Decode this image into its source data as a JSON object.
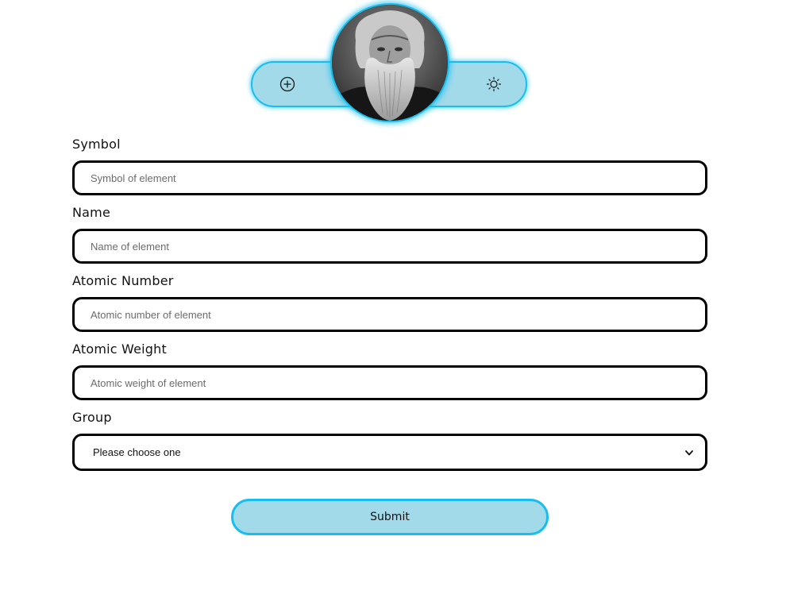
{
  "header": {
    "add_icon": "plus-circle-icon",
    "theme_icon": "sun-icon",
    "portrait_alt": "portrait"
  },
  "form": {
    "fields": [
      {
        "label": "Symbol",
        "placeholder": "Symbol of element",
        "value": ""
      },
      {
        "label": "Name",
        "placeholder": "Name of element",
        "value": ""
      },
      {
        "label": "Atomic Number",
        "placeholder": "Atomic number of element",
        "value": ""
      },
      {
        "label": "Atomic Weight",
        "placeholder": "Atomic weight of element",
        "value": ""
      }
    ],
    "group": {
      "label": "Group",
      "selected": "Please choose one"
    },
    "submit_label": "Submit"
  },
  "colors": {
    "accent": "#17bff0",
    "accent_fill": "#a3dae9",
    "border": "#000000"
  }
}
